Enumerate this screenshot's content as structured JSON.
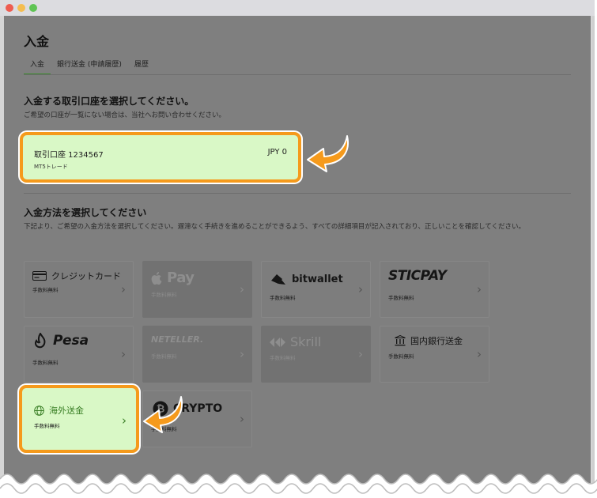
{
  "page": {
    "title": "入金",
    "tabs": [
      {
        "label": "入金"
      },
      {
        "label": "銀行送金 (申請履歴)"
      },
      {
        "label": "履歴"
      }
    ]
  },
  "account_section": {
    "title": "入金する取引口座を選択してください。",
    "subtitle": "ご希望の口座が一覧にない場合は、当社へお問い合わせください。",
    "account": {
      "name": "取引口座 1234567",
      "balance": "JPY 0",
      "type": "MT5トレード"
    }
  },
  "method_section": {
    "title": "入金方法を選択してください",
    "description": "下記より、ご希望の入金方法を選択してください。遅滞なく手続きを進めることができるよう、すべての詳細項目が記入されており、正しいことを確認してください。"
  },
  "methods": [
    {
      "label": "クレジットカード",
      "fee": "手数料無料"
    },
    {
      "label": "Pay",
      "fee": "手数料無料"
    },
    {
      "label": "bitwallet",
      "fee": "手数料無料"
    },
    {
      "label": "STICPAY",
      "fee": "手数料無料"
    },
    {
      "label": "Pesa",
      "fee": "手数料無料"
    },
    {
      "label": "NETELLER.",
      "fee": "手数料無料"
    },
    {
      "label": "Skrill",
      "fee": "手数料無料"
    },
    {
      "label": "国内銀行送金",
      "fee": "手数料無料"
    },
    {
      "label": "海外送金",
      "fee": "手数料無料"
    },
    {
      "label": "CRYPTO",
      "fee": "手数料無料"
    }
  ],
  "colors": {
    "highlight_border": "#f59a1c",
    "highlight_fill": "#d9f8c6",
    "accent_green": "#3a7f26",
    "overlay": "#7f7f7f"
  },
  "icons": {
    "credit_card": "credit-card-icon",
    "globe": "globe-icon",
    "bank": "bank-icon",
    "crypto": "bitcoin-icon",
    "chevron": "chevron-right-icon",
    "arrow": "pointer-arrow-icon"
  }
}
